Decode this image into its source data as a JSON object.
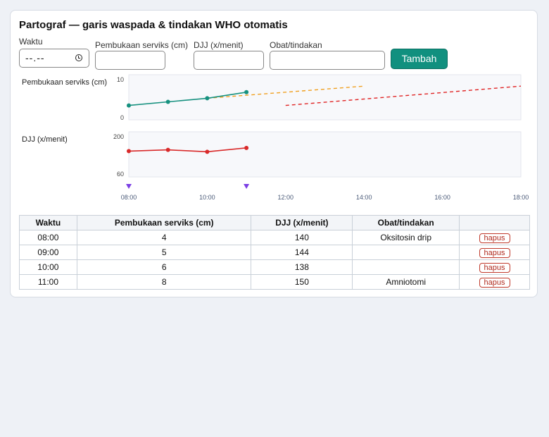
{
  "app": {
    "title": "Partograf — garis waspada & tindakan WHO otomatis"
  },
  "form": {
    "time_label": "Waktu",
    "time_value": "--.--",
    "dilation_label": "Pembukaan serviks (cm)",
    "fhr_label": "DJJ (x/menit)",
    "drug_label": "Obat/tindakan",
    "add_button": "Tambah"
  },
  "chart_data": [
    {
      "type": "line",
      "ylabel": "Pembukaan serviks (cm)",
      "ylim": [
        0,
        10
      ],
      "yticks": [
        "10",
        "0"
      ],
      "x": [
        "08:00",
        "09:00",
        "10:00",
        "11:00"
      ],
      "series": [
        {
          "values": [
            4,
            5,
            6,
            8
          ],
          "color": "#16917f"
        }
      ],
      "reference_lines": [
        {
          "style": "dashed",
          "color": "#f0a020",
          "from": [
            "10:00",
            6
          ],
          "to": [
            "14:00",
            10
          ]
        },
        {
          "style": "dashed",
          "color": "#e02424",
          "from": [
            "12:00",
            4
          ],
          "to": [
            "18:00",
            10
          ]
        }
      ],
      "grid": false
    },
    {
      "type": "line",
      "ylabel": "DJJ (x/menit)",
      "ylim": [
        60,
        200
      ],
      "yticks": [
        "200",
        "60"
      ],
      "x": [
        "08:00",
        "09:00",
        "10:00",
        "11:00"
      ],
      "series": [
        {
          "values": [
            140,
            144,
            138,
            150
          ],
          "color": "#d92a2a"
        }
      ],
      "grid": false
    }
  ],
  "xaxis": {
    "ticks": [
      "08:00",
      "10:00",
      "12:00",
      "14:00",
      "16:00",
      "18:00"
    ],
    "range_hours": [
      8,
      18
    ],
    "intervention_markers": [
      "08:00",
      "11:00"
    ],
    "marker_color": "#7b3fe4"
  },
  "table": {
    "headers": [
      "Waktu",
      "Pembukaan serviks (cm)",
      "DJJ (x/menit)",
      "Obat/tindakan",
      ""
    ],
    "rows": [
      {
        "time": "08:00",
        "dilation": "4",
        "fhr": "140",
        "drug": "Oksitosin drip",
        "action": "hapus"
      },
      {
        "time": "09:00",
        "dilation": "5",
        "fhr": "144",
        "drug": "",
        "action": "hapus"
      },
      {
        "time": "10:00",
        "dilation": "6",
        "fhr": "138",
        "drug": "",
        "action": "hapus"
      },
      {
        "time": "11:00",
        "dilation": "8",
        "fhr": "150",
        "drug": "Amniotomi",
        "action": "hapus"
      }
    ]
  }
}
